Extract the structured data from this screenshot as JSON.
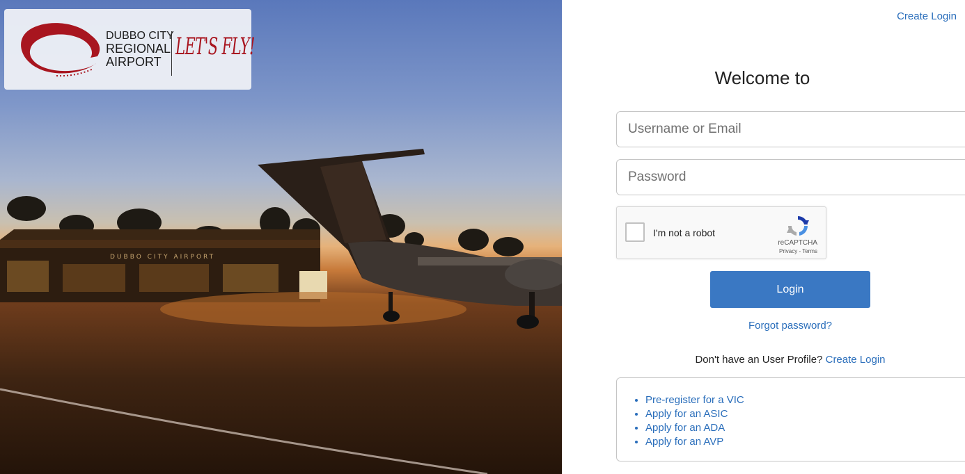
{
  "logo": {
    "line1": "DUBBO CITY",
    "line2": "REGIONAL",
    "line3": "AIRPORT",
    "slogan": "LET'S FLY!",
    "terminal_sign": "DUBBO CITY AIRPORT",
    "brand_color": "#a8151f"
  },
  "header": {
    "create_login": "Create Login"
  },
  "form": {
    "title": "Welcome to",
    "username_placeholder": "Username or Email",
    "password_placeholder": "Password",
    "captcha": {
      "label": "I'm not a robot",
      "brand": "reCAPTCHA",
      "privacy": "Privacy",
      "separator": " - ",
      "terms": "Terms"
    },
    "login_label": "Login",
    "forgot_password": "Forgot password?",
    "no_profile_text": "Don't have an User Profile?",
    "create_login": "Create Login",
    "accent_color": "#3a78c3"
  },
  "quick_links": [
    {
      "label": "Pre-register for a VIC"
    },
    {
      "label": "Apply for an ASIC"
    },
    {
      "label": "Apply for an ADA"
    },
    {
      "label": "Apply for an AVP"
    }
  ]
}
